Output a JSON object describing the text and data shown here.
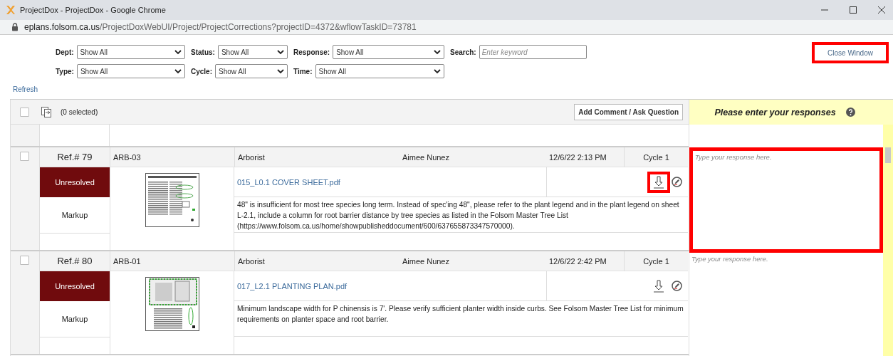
{
  "window": {
    "title": "ProjectDox - ProjectDox - Google Chrome"
  },
  "address_bar": {
    "host": "eplans.folsom.ca.us",
    "path": "/ProjectDoxWebUI/Project/ProjectCorrections?projectID=4372&wflowTaskID=73781"
  },
  "filters": [
    {
      "kind": "select",
      "label": "Dept:",
      "value": "Show All"
    },
    {
      "kind": "select",
      "label": "Status:",
      "value": "Show All"
    },
    {
      "kind": "select",
      "label": "Response:",
      "value": "Show All"
    },
    {
      "kind": "search",
      "label": "Search:",
      "placeholder": "Enter keyword"
    },
    {
      "kind": "select",
      "label": "Type:",
      "value": "Show All"
    },
    {
      "kind": "select",
      "label": "Cycle:",
      "value": "Show All"
    },
    {
      "kind": "select",
      "label": "Time:",
      "value": "Show All"
    }
  ],
  "close_button": {
    "label": "Close Window",
    "highlighted": true
  },
  "refresh_link": "Refresh",
  "toolbar": {
    "select_all_checked": false,
    "selected_count": "(0 selected)",
    "add_button": "Add Comment / Ask Question"
  },
  "response_panel": {
    "title": "Please enter your responses"
  },
  "items": [
    {
      "checked": false,
      "ref": "Ref.# 79",
      "code": "ARB-03",
      "discipline": "Arborist",
      "reviewer": "Aimee Nunez",
      "date": "12/6/22 2:13 PM",
      "cycle": "Cycle 1",
      "status": "Unresolved",
      "type": "Markup",
      "file": "015_L0.1 COVER SHEET.pdf",
      "comment": "48\" is insufficient for most tree species long term. Instead of spec'ing 48\", please refer to the plant legend and in the plant legend on sheet L-2.1, include a column for root barrier distance by tree species as listed in the Folsom Master Tree List (https://www.folsom.ca.us/home/showpublisheddocument/600/637655873347570000).",
      "download_highlighted": true,
      "response_placeholder": "Type your response here.",
      "response_highlighted": true
    },
    {
      "checked": false,
      "ref": "Ref.# 80",
      "code": "ARB-01",
      "discipline": "Arborist",
      "reviewer": "Aimee Nunez",
      "date": "12/6/22 2:42 PM",
      "cycle": "Cycle 1",
      "status": "Unresolved",
      "type": "Markup",
      "file": "017_L2.1 PLANTING PLAN.pdf",
      "comment": "Minimum landscape width for P chinensis is 7'. Please verify sufficient planter width inside curbs. See Folsom Master Tree List for minimum requirements on planter space and root barrier.",
      "download_highlighted": false,
      "response_placeholder": "Type your response here.",
      "response_highlighted": false
    }
  ]
}
